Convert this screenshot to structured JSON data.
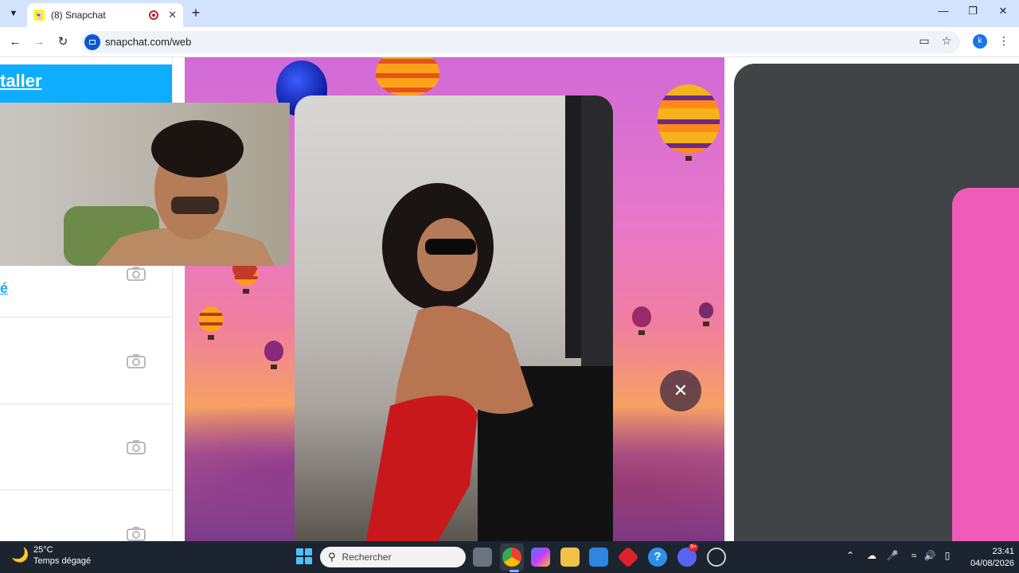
{
  "browser": {
    "tab_title": "(8) Snapchat",
    "url": "snapchat.com/web",
    "profile_initial": "k"
  },
  "icons": {
    "tab_search": "chevron-down-icon",
    "close_tab": "close-icon",
    "new_tab": "plus-icon",
    "back": "arrow-left-icon",
    "forward": "arrow-right-icon",
    "reload": "reload-icon",
    "install_app": "install-icon",
    "bookmark": "star-icon",
    "menu": "kebab-menu-icon"
  },
  "sidebar": {
    "install_link": "taller",
    "partial_link": "é",
    "camera_rows": 4
  },
  "story": {
    "close_label": "✕"
  },
  "taskbar": {
    "weather_temp": "25°C",
    "weather_desc": "Temps dégagé",
    "search_placeholder": "Rechercher",
    "discord_badge": "9+",
    "time": "23:41",
    "date": "04/08/2026"
  },
  "colors": {
    "snap_blue": "#0fadff",
    "pink_card": "#ee5cb8",
    "chrome_tabbar": "#d3e3fd",
    "taskbar_bg": "#1c2430"
  }
}
